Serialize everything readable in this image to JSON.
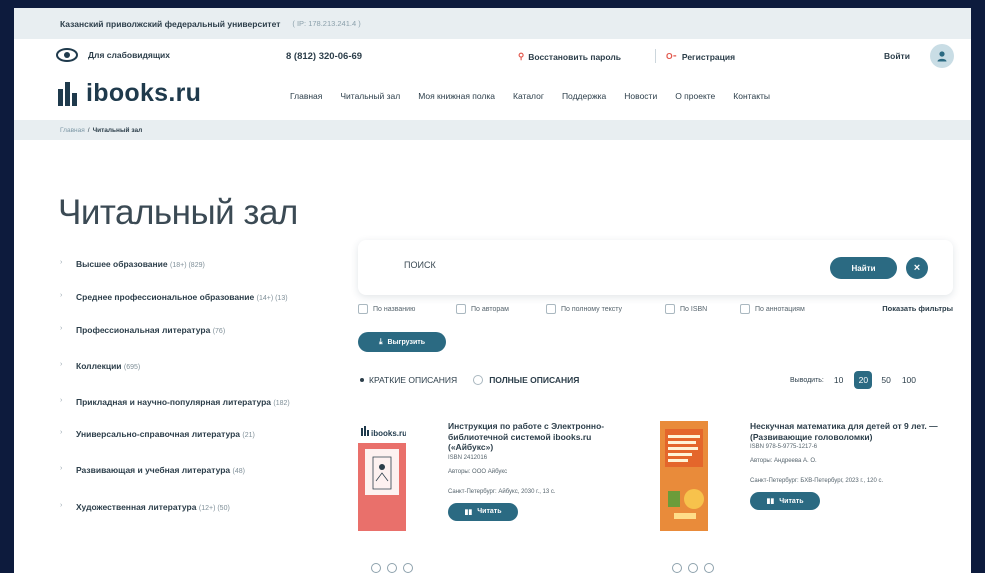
{
  "topbar": {
    "university": "Казанский приволжский федеральный университет",
    "ip": "( IP: 178.213.241.4 )"
  },
  "header": {
    "accessibility": "Для слабовидящих",
    "phone": "8 (812) 320-06-69",
    "restore_password": "Восстановить пароль",
    "register": "Регистрация",
    "login": "Войти"
  },
  "logo": {
    "text": "ibooks.ru"
  },
  "nav": [
    "Главная",
    "Читальный зал",
    "Моя книжная полка",
    "Каталог",
    "Поддержка",
    "Новости",
    "О проекте",
    "Контакты"
  ],
  "breadcrumb": {
    "home": "Главная",
    "separator": "/",
    "current": "Читальный зал"
  },
  "page_title": "Читальный зал",
  "categories": [
    {
      "name": "Высшее образование",
      "count": "(18+) (829)"
    },
    {
      "name": "Среднее профессиональное образование",
      "count": "(14+) (13)"
    },
    {
      "name": "Профессиональная литература",
      "count": "(76)"
    },
    {
      "name": "Коллекции",
      "count": "(695)"
    },
    {
      "name": "Прикладная и научно-популярная литература",
      "count": "(182)"
    },
    {
      "name": "Универсально-справочная литература",
      "count": "(21)"
    },
    {
      "name": "Развивающая и учебная литература",
      "count": "(48)"
    },
    {
      "name": "Художественная литература",
      "count": "(12+) (50)"
    }
  ],
  "search": {
    "placeholder": "ПОИСК",
    "find": "Найти",
    "clear": "×"
  },
  "filters": {
    "options": [
      "По названию",
      "По авторам",
      "По полному тексту",
      "По ISBN",
      "По аннотациям"
    ],
    "show_filters": "Показать фильтры"
  },
  "export_label": "Выгрузить",
  "view_modes": {
    "short": "КРАТКИЕ ОПИСАНИЯ",
    "full": "ПОЛНЫЕ ОПИСАНИЯ"
  },
  "per_page": {
    "label": "Выводить:",
    "options": [
      "10",
      "20",
      "50",
      "100"
    ],
    "selected": "20"
  },
  "books": [
    {
      "title": "Инструкция по работе с Электронно-библиотечной системой ibooks.ru («Айбукс»)",
      "isbn": "ISBN 2412016",
      "authors": "Авторы: ООО Айбукс",
      "publisher": "Санкт-Петербург: Айбукс, 2030 г., 13 с.",
      "cover_logo": "ibooks.ru",
      "read": "Читать"
    },
    {
      "title": "Нескучная математика для детей от 9 лет. — (Развивающие головоломки)",
      "isbn": "ISBN 978-5-9775-1217-6",
      "authors": "Авторы: Андреева А. О.",
      "publisher": "Санкт-Петербург: БХВ-Петербург, 2023 г., 120 с.",
      "read": "Читать"
    }
  ],
  "colors": {
    "accent": "#2b6a82",
    "dark_text": "#2c3e4a",
    "light_bg": "#e8eef1",
    "frame_bg": "#0d1b3d",
    "red_icon": "#e2574c"
  }
}
